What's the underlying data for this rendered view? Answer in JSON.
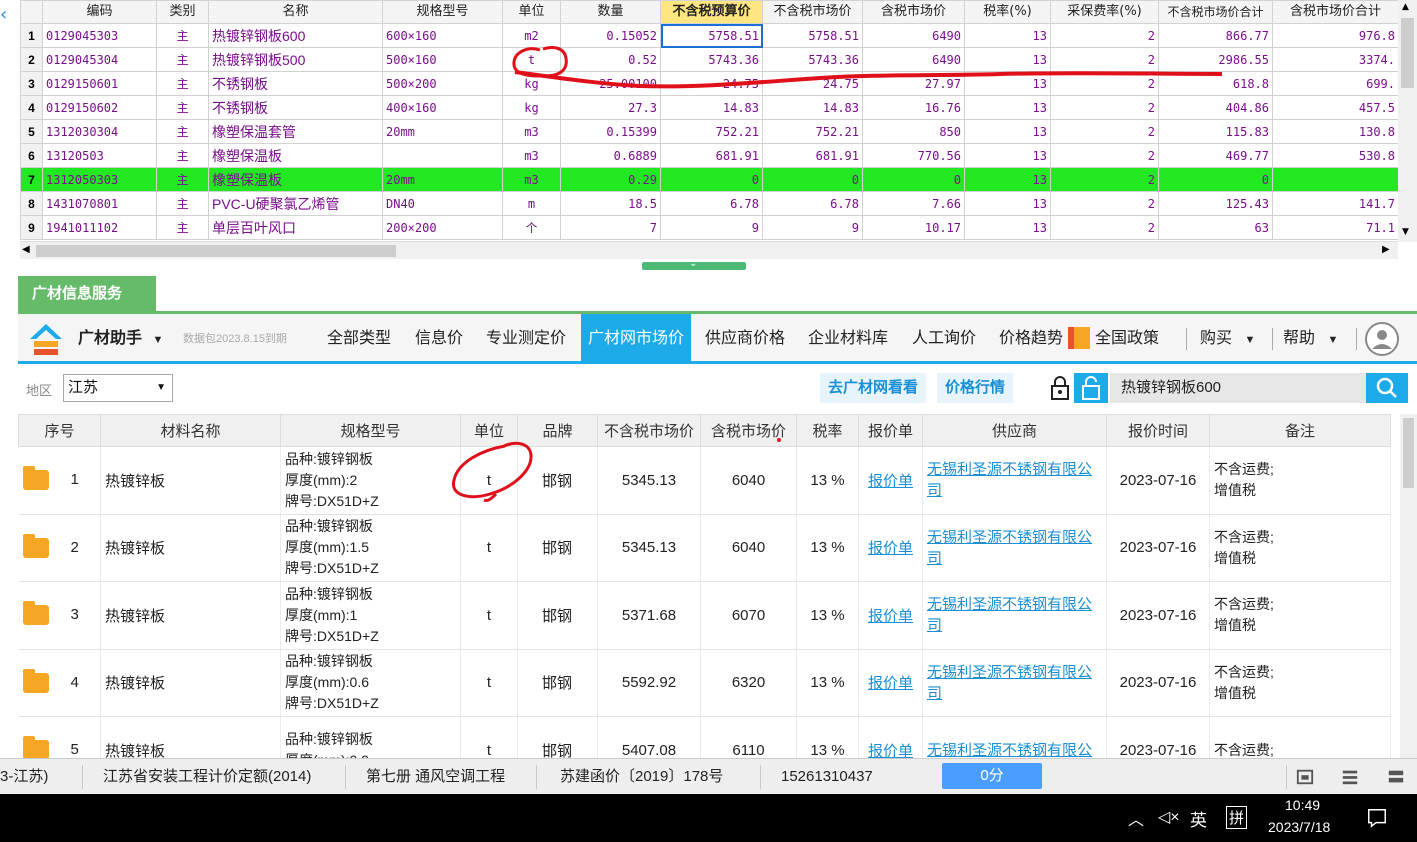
{
  "top_grid": {
    "headers": [
      "",
      "编码",
      "类别",
      "名称",
      "规格型号",
      "单位",
      "数量",
      "不含税预算价",
      "不含税市场价",
      "含税市场价",
      "税率(%)",
      "采保费率(%)",
      "不含税市场价合计",
      "含税市场价合计"
    ],
    "rows": [
      {
        "n": "1",
        "code": "0129045303",
        "type": "主",
        "name": "热镀锌钢板600",
        "spec": "600×160",
        "unit": "m2",
        "qty": "0.15052",
        "budget": "5758.51",
        "market": "5758.51",
        "tax_market": "6490",
        "tax_rate": "13",
        "fee": "2",
        "total": "866.77",
        "tax_total": "976.8"
      },
      {
        "n": "2",
        "code": "0129045304",
        "type": "主",
        "name": "热镀锌钢板500",
        "spec": "500×160",
        "unit": "t",
        "qty": "0.52",
        "budget": "5743.36",
        "market": "5743.36",
        "tax_market": "6490",
        "tax_rate": "13",
        "fee": "2",
        "total": "2986.55",
        "tax_total": "3374."
      },
      {
        "n": "3",
        "code": "0129150601",
        "type": "主",
        "name": "不锈钢板",
        "spec": "500×200",
        "unit": "kg",
        "qty": "25.00100",
        "budget": "24.75",
        "market": "24.75",
        "tax_market": "27.97",
        "tax_rate": "13",
        "fee": "2",
        "total": "618.8",
        "tax_total": "699."
      },
      {
        "n": "4",
        "code": "0129150602",
        "type": "主",
        "name": "不锈钢板",
        "spec": "400×160",
        "unit": "kg",
        "qty": "27.3",
        "budget": "14.83",
        "market": "14.83",
        "tax_market": "16.76",
        "tax_rate": "13",
        "fee": "2",
        "total": "404.86",
        "tax_total": "457.5"
      },
      {
        "n": "5",
        "code": "1312030304",
        "type": "主",
        "name": "橡塑保温套管",
        "spec": "20mm",
        "unit": "m3",
        "qty": "0.15399",
        "budget": "752.21",
        "market": "752.21",
        "tax_market": "850",
        "tax_rate": "13",
        "fee": "2",
        "total": "115.83",
        "tax_total": "130.8"
      },
      {
        "n": "6",
        "code": "13120503",
        "type": "主",
        "name": "橡塑保温板",
        "spec": "",
        "unit": "m3",
        "qty": "0.6889",
        "budget": "681.91",
        "market": "681.91",
        "tax_market": "770.56",
        "tax_rate": "13",
        "fee": "2",
        "total": "469.77",
        "tax_total": "530.8"
      },
      {
        "n": "7",
        "code": "1312050303",
        "type": "主",
        "name": "橡塑保温板",
        "spec": "20mm",
        "unit": "m3",
        "qty": "0.29",
        "budget": "0",
        "market": "0",
        "tax_market": "0",
        "tax_rate": "13",
        "fee": "2",
        "total": "0",
        "tax_total": ""
      },
      {
        "n": "8",
        "code": "1431070801",
        "type": "主",
        "name": "PVC-U硬聚氯乙烯管",
        "spec": "DN40",
        "unit": "m",
        "qty": "18.5",
        "budget": "6.78",
        "market": "6.78",
        "tax_market": "7.66",
        "tax_rate": "13",
        "fee": "2",
        "total": "125.43",
        "tax_total": "141.7"
      },
      {
        "n": "9",
        "code": "1941011102",
        "type": "主",
        "name": "单层百叶风口",
        "spec": "200×200",
        "unit": "个",
        "qty": "7",
        "budget": "9",
        "market": "9",
        "tax_market": "10.17",
        "tax_rate": "13",
        "fee": "2",
        "total": "63",
        "tax_total": "71.1"
      }
    ]
  },
  "service_tab": "广材信息服务",
  "toolbar": {
    "assistant": "广材助手",
    "data_pkg": "数据包2023.8.15到期",
    "tabs": [
      "全部类型",
      "信息价",
      "专业测定价",
      "广材网市场价",
      "供应商价格",
      "企业材料库",
      "人工询价",
      "价格趋势",
      "全国政策"
    ],
    "active_tab": "广材网市场价",
    "buy": "购买",
    "help": "帮助"
  },
  "filter": {
    "region_label": "地区",
    "region": "江苏",
    "visit_site": "去广材网看看",
    "market_trend": "价格行情",
    "search": "热镀锌钢板600"
  },
  "result_table": {
    "headers": [
      "序号",
      "材料名称",
      "规格型号",
      "单位",
      "品牌",
      "不含税市场价",
      "含税市场价",
      "税率",
      "报价单",
      "供应商",
      "报价时间",
      "备注"
    ],
    "rows": [
      {
        "n": "1",
        "name": "热镀锌板",
        "spec1": "品种:镀锌钢板",
        "spec2": "厚度(mm):2",
        "spec3": "牌号:DX51D+Z",
        "unit": "t",
        "brand": "邯钢",
        "price": "5345.13",
        "tax_price": "6040",
        "rate": "13 %",
        "quote": "报价单",
        "supplier1": "无锡利圣源不锈钢有限公",
        "supplier2": "司",
        "date": "2023-07-16",
        "note1": "不含运费;",
        "note2": "增值税"
      },
      {
        "n": "2",
        "name": "热镀锌板",
        "spec1": "品种:镀锌钢板",
        "spec2": "厚度(mm):1.5",
        "spec3": "牌号:DX51D+Z",
        "unit": "t",
        "brand": "邯钢",
        "price": "5345.13",
        "tax_price": "6040",
        "rate": "13 %",
        "quote": "报价单",
        "supplier1": "无锡利圣源不锈钢有限公",
        "supplier2": "司",
        "date": "2023-07-16",
        "note1": "不含运费;",
        "note2": "增值税"
      },
      {
        "n": "3",
        "name": "热镀锌板",
        "spec1": "品种:镀锌钢板",
        "spec2": "厚度(mm):1",
        "spec3": "牌号:DX51D+Z",
        "unit": "t",
        "brand": "邯钢",
        "price": "5371.68",
        "tax_price": "6070",
        "rate": "13 %",
        "quote": "报价单",
        "supplier1": "无锡利圣源不锈钢有限公",
        "supplier2": "司",
        "date": "2023-07-16",
        "note1": "不含运费;",
        "note2": "增值税"
      },
      {
        "n": "4",
        "name": "热镀锌板",
        "spec1": "品种:镀锌钢板",
        "spec2": "厚度(mm):0.6",
        "spec3": "牌号:DX51D+Z",
        "unit": "t",
        "brand": "邯钢",
        "price": "5592.92",
        "tax_price": "6320",
        "rate": "13 %",
        "quote": "报价单",
        "supplier1": "无锡利圣源不锈钢有限公",
        "supplier2": "司",
        "date": "2023-07-16",
        "note1": "不含运费;",
        "note2": "增值税"
      },
      {
        "n": "5",
        "name": "热镀锌板",
        "spec1": "品种:镀锌钢板",
        "spec2": "厚度(mm):0.9",
        "spec3": "",
        "unit": "t",
        "brand": "邯钢",
        "price": "5407.08",
        "tax_price": "6110",
        "rate": "13 %",
        "quote": "报价单",
        "supplier1": "无锡利圣源不锈钢有限公",
        "supplier2": "",
        "date": "2023-07-16",
        "note1": "不含运费;",
        "note2": ""
      }
    ]
  },
  "status_bar": {
    "region": "3-江苏)",
    "quota": "江苏省安装工程计价定额(2014)",
    "volume": "第七册 通风空调工程",
    "doc": "苏建函价〔2019〕178号",
    "phone": "15261310437",
    "score": "0分"
  },
  "taskbar": {
    "ime1": "英",
    "ime2": "拼",
    "time": "10:49",
    "date": "2023/7/18"
  },
  "colors": {
    "accent": "#1daae8",
    "service_green": "#66bb6a",
    "row_highlight": "#22e822",
    "annotation_red": "#e0101a"
  }
}
